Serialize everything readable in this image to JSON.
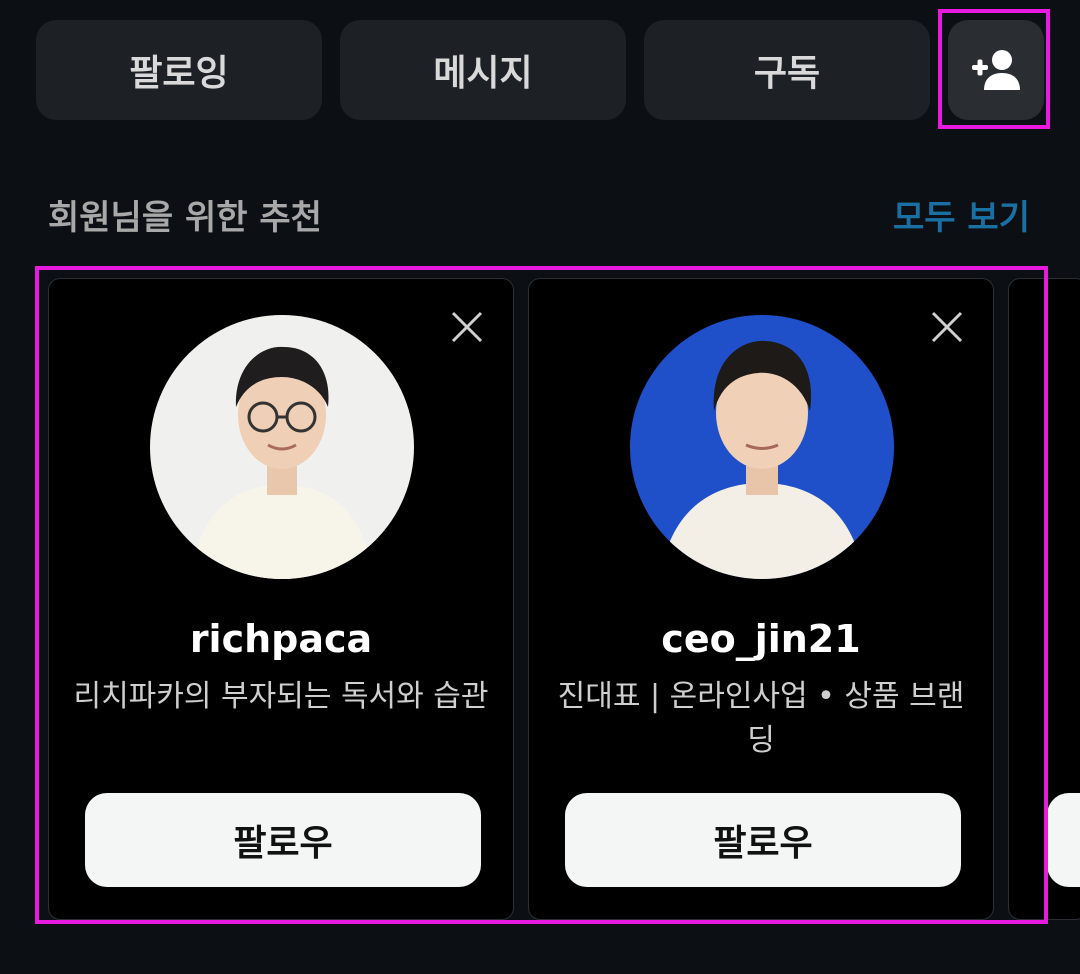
{
  "top_buttons": {
    "following": "팔로잉",
    "message": "메시지",
    "subscribe": "구독",
    "add_person_icon": "person-add-icon"
  },
  "suggestions": {
    "title": "회원님을 위한 추천",
    "see_all": "모두 보기",
    "cards": [
      {
        "username": "richpaca",
        "bio": "리치파카의 부자되는 독서와 습관",
        "follow_label": "팔로우",
        "avatar_bg": "#f0f0ee"
      },
      {
        "username": "ceo_jin21",
        "bio": "진대표 | 온라인사업 • 상품 브랜딩",
        "follow_label": "팔로우",
        "avatar_bg": "#1f4fc9"
      }
    ]
  },
  "colors": {
    "background": "#0c1014",
    "accent_link": "#1a6fa3",
    "highlight_box": "#e81adf"
  }
}
